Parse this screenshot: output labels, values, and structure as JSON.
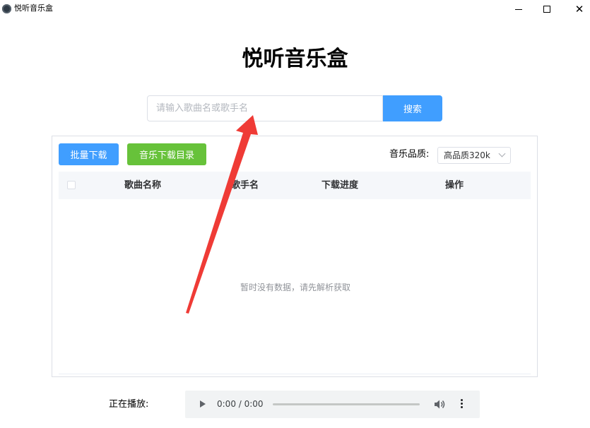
{
  "window": {
    "title": "悦听音乐盒",
    "minimize_label": "–",
    "maximize_label": "□",
    "close_label": "✕"
  },
  "header": {
    "title": "悦听音乐盒"
  },
  "search": {
    "placeholder": "请输入歌曲名或歌手名",
    "value": "",
    "button_label": "搜索"
  },
  "toolbar": {
    "batch_download_label": "批量下载",
    "download_folder_label": "音乐下载目录",
    "quality_label": "音乐品质:",
    "quality_value": "高品质320k"
  },
  "table": {
    "columns": [
      "歌曲名称",
      "歌手名",
      "下载进度",
      "操作"
    ],
    "rows": [],
    "empty_text": "暂时没有数据，请先解析获取"
  },
  "player": {
    "label": "正在播放:",
    "time": "0:00 / 0:00",
    "progress": 0
  },
  "colors": {
    "primary": "#409eff",
    "success": "#67c23a",
    "annotation_arrow": "#ef3b36"
  },
  "icons": {
    "app": "app-icon",
    "play": "play-icon",
    "volume": "volume-icon",
    "more": "more-vertical-icon",
    "dropdown": "chevron-down-icon"
  }
}
